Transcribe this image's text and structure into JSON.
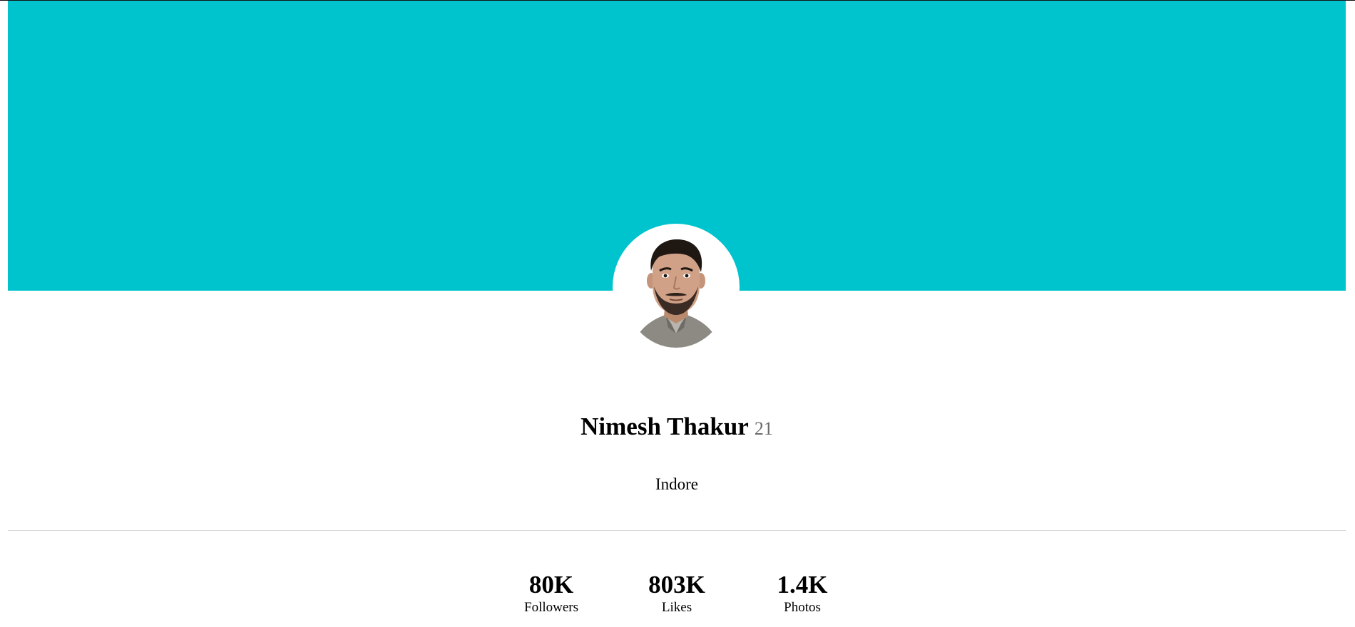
{
  "theme": {
    "cover_color": "#00c4cd",
    "age_color": "#6b6b6b",
    "divider_color": "#d8d8d8"
  },
  "profile": {
    "avatar_icon": "profile-photo",
    "name": "Nimesh Thakur",
    "age": "21",
    "city": "Indore"
  },
  "stats": [
    {
      "value": "80K",
      "label": "Followers"
    },
    {
      "value": "803K",
      "label": "Likes"
    },
    {
      "value": "1.4K",
      "label": "Photos"
    }
  ]
}
